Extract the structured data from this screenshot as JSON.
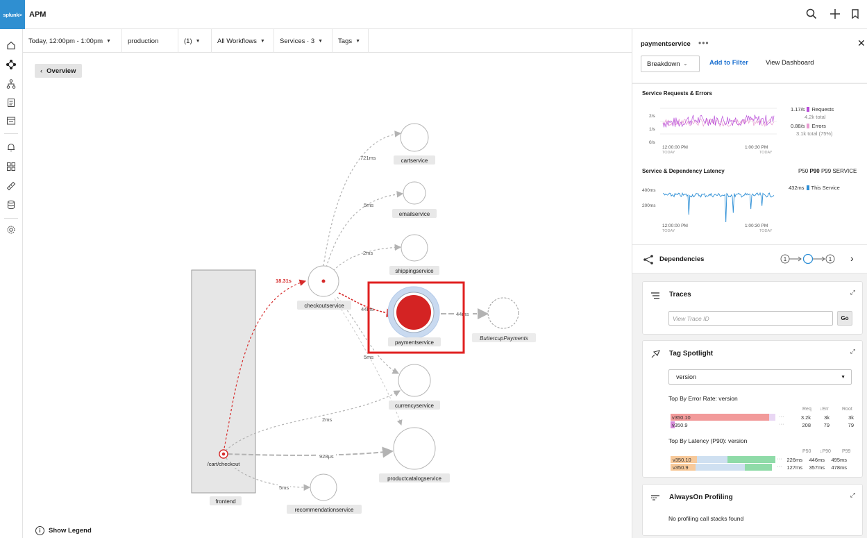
{
  "header": {
    "logo_text": "splunk>",
    "app_title": "APM",
    "icons": [
      "search-icon",
      "plus-icon",
      "bookmark-icon"
    ]
  },
  "leftnav": {
    "icons": [
      "home-icon",
      "apm-service-map-icon",
      "hierarchy-icon",
      "logs-icon",
      "synthetics-icon",
      "alerts-icon",
      "dashboards-icon",
      "ruler-icon",
      "database-icon",
      "settings-icon"
    ]
  },
  "filters": {
    "time": "Today, 12:00pm - 1:00pm",
    "environment": "production",
    "env_count": "(1)",
    "workflows": "All Workflows",
    "services": "Services · 3",
    "tags": "Tags"
  },
  "map": {
    "overview_button": "Overview",
    "show_legend": "Show Legend",
    "services": {
      "frontend": "frontend",
      "cart_checkout": "/cart/checkout",
      "checkout": "checkoutservice",
      "cart": "cartservice",
      "email": "emailservice",
      "shipping": "shippingservice",
      "payment": "paymentservice",
      "buttercup": "ButtercupPayments",
      "currency": "currencyservice",
      "productcatalog": "productcatalogservice",
      "recommendation": "recommendationservice"
    },
    "edge_labels": {
      "frontend_checkout": "18.31s",
      "checkout_cart": "721ms",
      "checkout_email": "5ms",
      "checkout_shipping": "2ms",
      "checkout_payment": "44ms",
      "payment_buttercup": "44ms",
      "checkout_currency": "5ms",
      "frontend_currency": "2ms",
      "frontend_productcatalog": "928µs",
      "frontend_recommendation": "5ms"
    },
    "colors": {
      "error": "#d62b2b",
      "selected_ring": "#c7d9ef",
      "highlight_box": "#e02020",
      "edge": "#b3b3b3"
    }
  },
  "panel": {
    "service_name": "paymentservice",
    "more": "•••",
    "breakdown": "Breakdown",
    "add_to_filter": "Add to Filter",
    "view_dashboard": "View Dashboard",
    "requests_errors": {
      "title": "Service Requests & Errors",
      "y_ticks": [
        "2/s",
        "1/s",
        "0/s"
      ],
      "x_start": "12:00:00 PM",
      "x_end": "1:00:30 PM",
      "x_sub": "TODAY",
      "requests_rate": "1.17/s",
      "requests_label": "Requests",
      "requests_total": "4.2k total",
      "errors_rate": "0.88/s",
      "errors_label": "Errors",
      "errors_total": "3.1k total (75%)",
      "request_color": "#b84cd9",
      "error_color": "#e89ad0"
    },
    "latency": {
      "title": "Service & Dependency Latency",
      "percentiles": [
        "P50",
        "P90",
        "P99",
        "SERVICE"
      ],
      "active_percentile": "P90",
      "y_ticks": [
        "400ms",
        "200ms"
      ],
      "x_start": "12:00:00 PM",
      "x_end": "1:00:30 PM",
      "x_sub": "TODAY",
      "value": "432ms",
      "value_label": "This Service",
      "line_color": "#2d8fd6"
    },
    "dependencies": {
      "title": "Dependencies",
      "left": "1",
      "right": "1"
    },
    "traces": {
      "title": "Traces",
      "placeholder": "View Trace ID",
      "go": "Go"
    },
    "tag_spotlight": {
      "title": "Tag Spotlight",
      "selected_tag": "version",
      "error_rate_title": "Top By Error Rate: version",
      "error_cols": [
        "Req",
        "↓Err",
        "Root"
      ],
      "error_rows": [
        {
          "label": "v350.10",
          "req": "3.2k",
          "err": "3k",
          "root": "3k",
          "fill": 0.94
        },
        {
          "label": "v350.9",
          "req": "208",
          "err": "79",
          "root": "79",
          "fill": 0.04
        }
      ],
      "latency_title": "Top By Latency (P90): version",
      "latency_cols": [
        "P50",
        "↓P90",
        "P99"
      ],
      "latency_rows": [
        {
          "label": "v350.10",
          "p50": "226ms",
          "p90": "446ms",
          "p99": "495ms"
        },
        {
          "label": "v350.9",
          "p50": "127ms",
          "p90": "357ms",
          "p99": "478ms"
        }
      ]
    },
    "profiling": {
      "title": "AlwaysOn Profiling",
      "message": "No profiling call stacks found"
    }
  }
}
